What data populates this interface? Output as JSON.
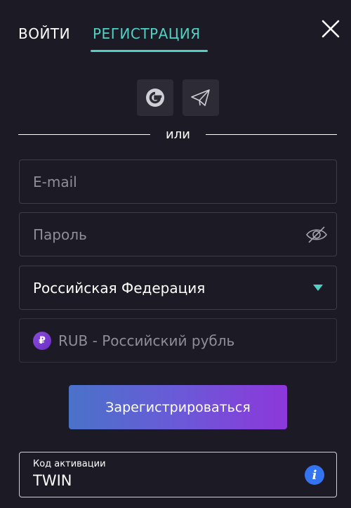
{
  "tabs": {
    "login": "ВОЙТИ",
    "register": "РЕГИСТРАЦИЯ",
    "active": "register"
  },
  "icons": {
    "close": "close-icon",
    "google": "google-icon",
    "telegram": "telegram-icon",
    "eye": "eye-slash-icon",
    "caret": "caret-down-icon",
    "ruble": "ruble-icon",
    "info": "info-icon"
  },
  "divider": {
    "label": "или"
  },
  "form": {
    "email": {
      "placeholder": "E-mail",
      "value": ""
    },
    "password": {
      "placeholder": "Пароль",
      "value": ""
    },
    "country": {
      "selected": "Российская Федерация"
    },
    "currency": {
      "symbol": "₽",
      "selected": "RUB - Российский рубль"
    },
    "submit_label": "Зарегистрироваться",
    "activation": {
      "label": "Код активации",
      "value": "TWIN"
    }
  },
  "colors": {
    "background": "#1c1b25",
    "accent": "#4fd1c5",
    "button_gradient_start": "#4a72c9",
    "button_gradient_end": "#8d37da",
    "info": "#3574f0"
  }
}
